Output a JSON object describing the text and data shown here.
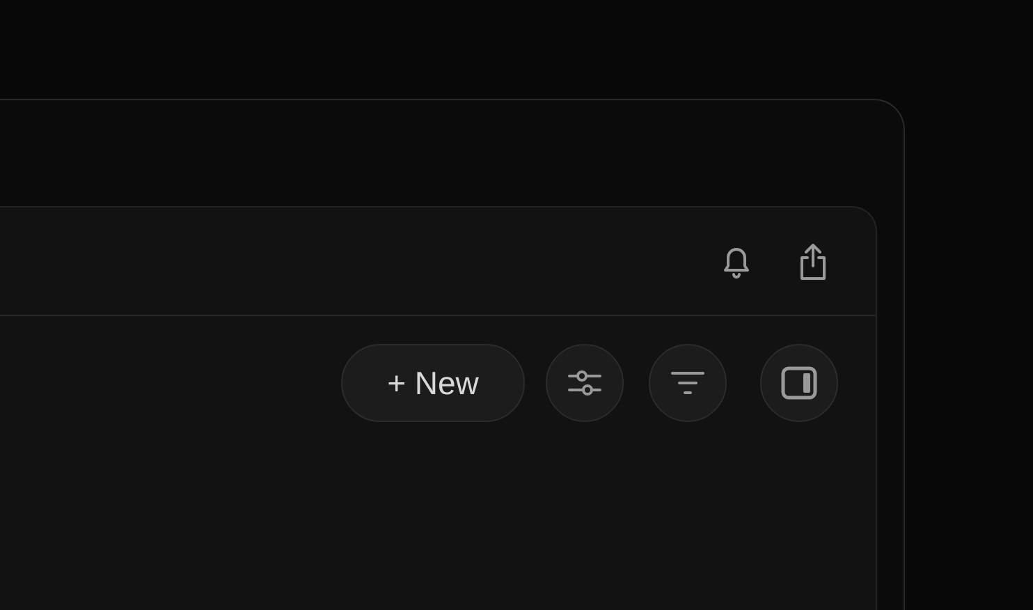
{
  "toolbar": {
    "new_button": {
      "label": "+ New"
    }
  }
}
